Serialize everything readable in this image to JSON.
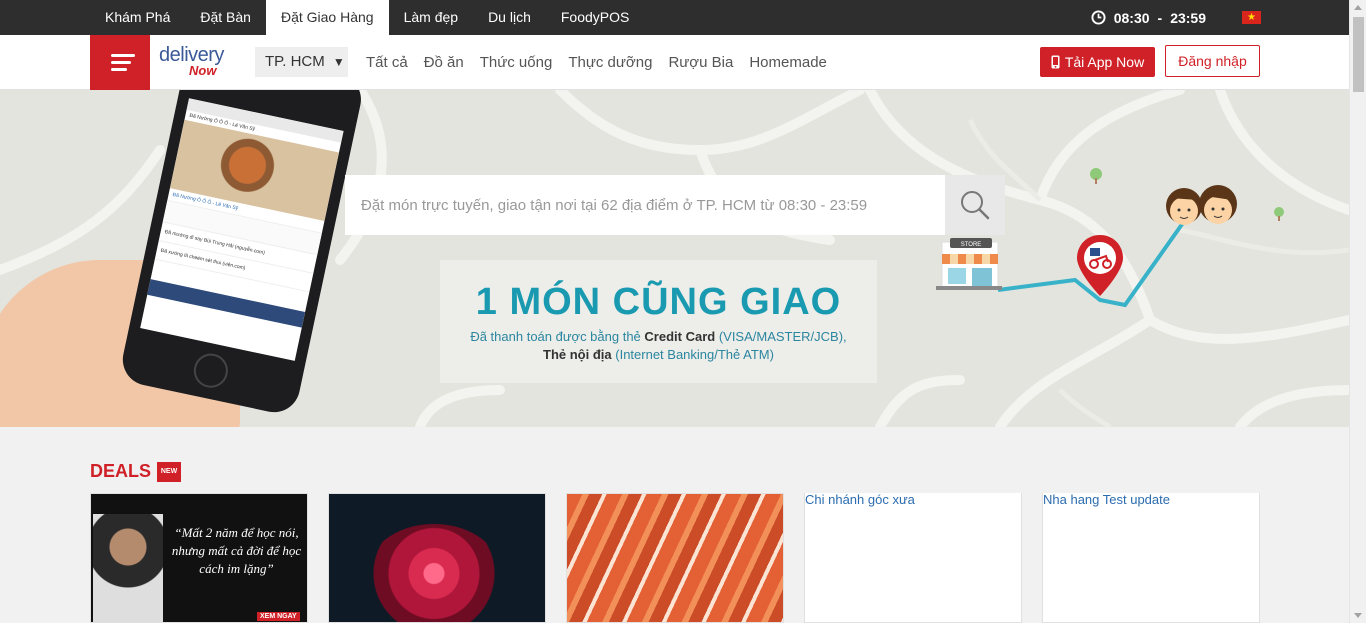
{
  "topnav": {
    "items": [
      {
        "label": "Khám Phá"
      },
      {
        "label": "Đặt Bàn"
      },
      {
        "label": "Đặt Giao Hàng"
      },
      {
        "label": "Làm đẹp"
      },
      {
        "label": "Du lịch"
      },
      {
        "label": "FoodyPOS"
      }
    ],
    "active_index": 2,
    "clock_icon": "clock-icon",
    "open_time": "08:30",
    "separator": "-",
    "close_time": "23:59",
    "flag_icon": "vietnam-flag-icon"
  },
  "header": {
    "logo_top": "delivery",
    "logo_bottom": "Now",
    "city": "TP. HCM",
    "city_caret": "▼",
    "categories": [
      "Tất cả",
      "Đồ ăn",
      "Thức uống",
      "Thực dưỡng",
      "Rượu Bia",
      "Homemade"
    ],
    "app_button": "Tải App Now",
    "login_button": "Đăng nhập"
  },
  "hero": {
    "search_placeholder": "Đặt món trực tuyến, giao tận nơi tại 62 địa điểm ở TP. HCM từ 08:30 - 23:59",
    "promo_headline": "1 MÓN CŨNG GIAO",
    "promo_line1_pre": "Đã thanh toán được bằng thẻ ",
    "promo_line1_bold": "Credit Card",
    "promo_line1_post": " (VISA/MASTER/JCB),",
    "promo_line2_bold": "Thẻ nội địa",
    "promo_line2_post": " (Internet Banking/Thẻ ATM)",
    "store_label": "STORE",
    "phone_app_title": "Đã Nướng Ô Ô Ô - Lê Văn Sỹ",
    "phone_item1": "Đã Nướng Ô Ô Ô - Lê Văn Sỹ",
    "phone_item2": "Đã mướng đi say Bùi Trung Hải (nguyễn.com)",
    "phone_item3": "Đã xướng là cheém sét thui (viên.com)"
  },
  "deals": {
    "title": "DEALS",
    "badge": "NEW",
    "cards": [
      {
        "type": "image",
        "quote": "“Mất 2 năm để học nói, nhưng mất cả đời để học cách im lặng”",
        "cta": "XEM NGAY"
      },
      {
        "type": "image",
        "title": ""
      },
      {
        "type": "image",
        "title": ""
      },
      {
        "type": "text",
        "title": "Chi nhánh góc xưa"
      },
      {
        "type": "text",
        "title": "Nha hang Test update"
      }
    ]
  },
  "colors": {
    "brand_red": "#cf2127",
    "topbar_bg": "#2e2e2e",
    "teal": "#1a9ab0",
    "link_blue": "#2b6cb0"
  }
}
